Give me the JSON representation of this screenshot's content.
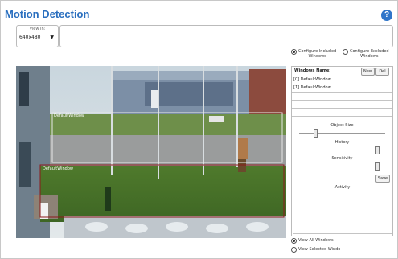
{
  "title": "Motion Detection",
  "help_glyph": "?",
  "view_in": {
    "label": "View In:",
    "value": "640x480"
  },
  "config_options": [
    {
      "line1": "Configure Included",
      "line2": "Windows",
      "selected": true
    },
    {
      "line1": "Configure Excluded",
      "line2": "Windows",
      "selected": false
    }
  ],
  "windows_panel": {
    "header_label": "Windows Name:",
    "new_label": "New",
    "del_label": "Del",
    "items": [
      "[0] DefaultWindow",
      "[1] DefaultWindow"
    ]
  },
  "sliders": {
    "object_size_label": "Object Size",
    "history_label": "History",
    "sensitivity_label": "Sensitivity",
    "object_size_level": 0.18,
    "history_level": 0.93,
    "sensitivity_level": 0.93
  },
  "save_label": "Save",
  "activity_label": "Activity",
  "video_overlays": {
    "window0_label": "DefaultWindow",
    "window1_label": "DefaultWindow"
  },
  "view_options": [
    {
      "label": "View All Windows",
      "selected": true
    },
    {
      "label": "View Selected Windo",
      "selected": false
    }
  ],
  "colors": {
    "title_blue": "#2a6fbf",
    "window_outline_white": "#e8e8e8",
    "window_outline_red": "#8b1a1a"
  }
}
